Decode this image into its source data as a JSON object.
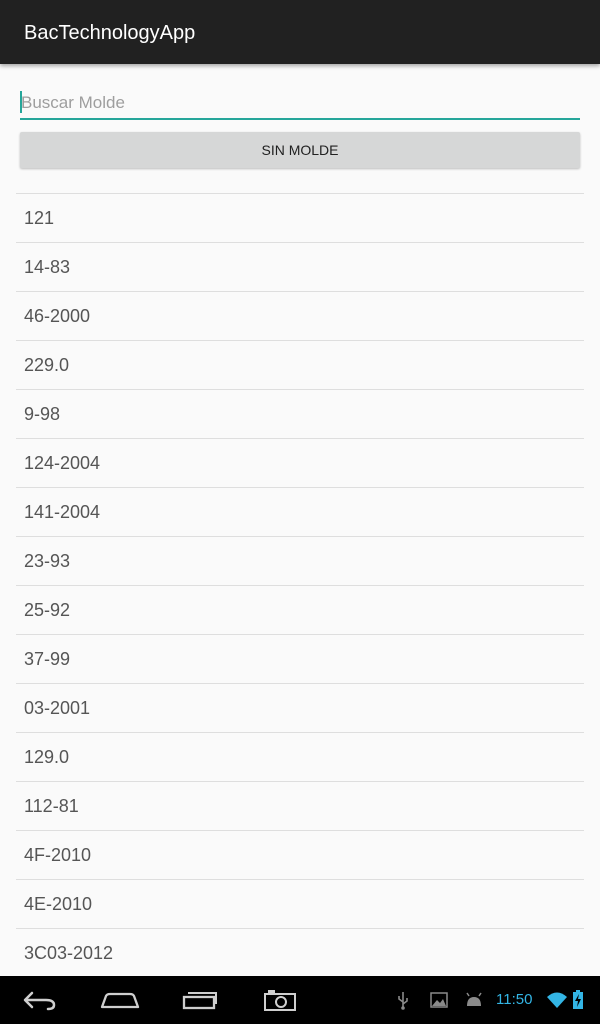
{
  "app": {
    "title": "BacTechnologyApp"
  },
  "search": {
    "placeholder": "Buscar Molde",
    "value": ""
  },
  "sin_molde_button": {
    "label": "SIN MOLDE"
  },
  "moldes": [
    "121",
    "14-83",
    "46-2000",
    "229.0",
    "9-98",
    "124-2004",
    "141-2004",
    "23-93",
    "25-92",
    "37-99",
    "03-2001",
    "129.0",
    "112-81",
    "4F-2010",
    "4E-2010",
    "3C03-2012"
  ],
  "system_bar": {
    "nav_icons": [
      "back-icon",
      "home-icon",
      "recent-apps-icon",
      "screenshot-icon"
    ],
    "status_icons": [
      "usb-icon",
      "gallery-icon",
      "android-debug-icon",
      "wifi-icon",
      "battery-charging-icon"
    ],
    "time": "11:50",
    "accent_color": "#33b5e5"
  },
  "colors": {
    "action_bar": "#212121",
    "accent": "#26a69a",
    "button_bg": "#d6d7d7",
    "background": "#fafafa"
  }
}
